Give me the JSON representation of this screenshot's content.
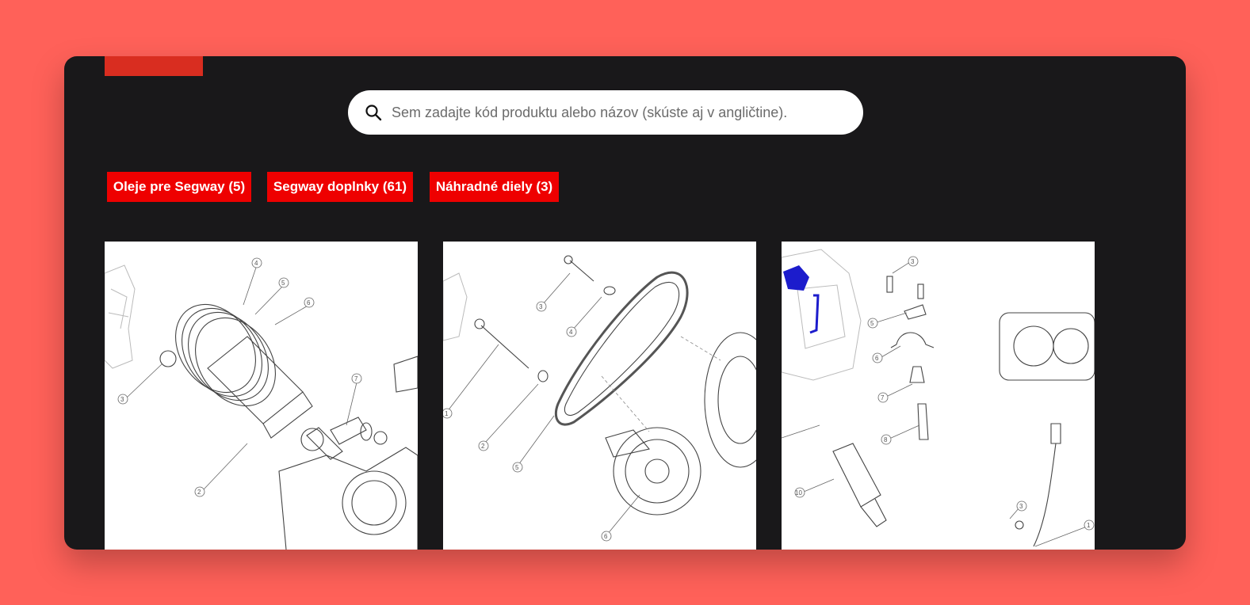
{
  "search": {
    "placeholder": "Sem zadajte kód produktu alebo názov (skúste aj v angličtine).",
    "icon": "search-icon"
  },
  "categories": [
    {
      "label": "Oleje pre Segway (5)"
    },
    {
      "label": "Segway doplnky (61)"
    },
    {
      "label": "Náhradné diely (3)"
    }
  ],
  "products": [
    {
      "image": "piston-assembly-diagram",
      "callouts": [
        "4",
        "5",
        "6",
        "3",
        "7",
        "2"
      ]
    },
    {
      "image": "drive-belt-clutch-diagram",
      "callouts": [
        "3",
        "4",
        "1",
        "2",
        "5",
        "6"
      ]
    },
    {
      "image": "throttle-body-injector-diagram",
      "callouts": [
        "3",
        "5",
        "6",
        "7",
        "8",
        "10",
        "3",
        "1"
      ]
    }
  ],
  "colors": {
    "background": "#ff6159",
    "panel": "#19181a",
    "accent": "#ee0000",
    "tab": "#d92d20"
  }
}
